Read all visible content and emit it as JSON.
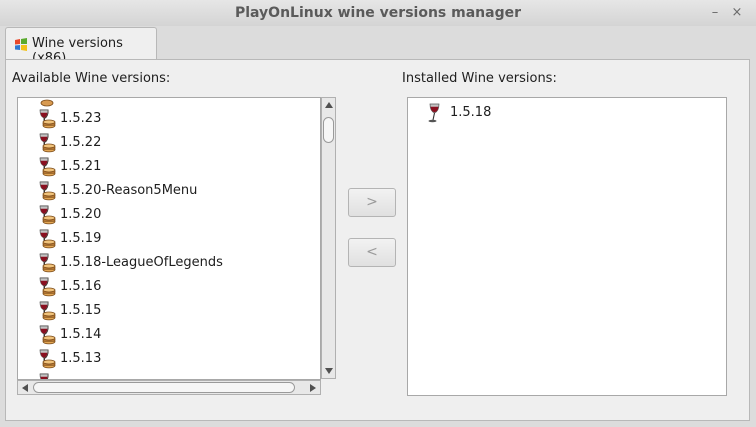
{
  "window": {
    "title": "PlayOnLinux wine versions manager",
    "minimize_glyph": "–",
    "close_glyph": "×"
  },
  "tab": {
    "label": "Wine versions (x86)",
    "icon": "windows-flag-icon"
  },
  "available": {
    "label": "Available Wine versions:",
    "item_icon": "wine-glass-icon",
    "items": [
      "1.5.23",
      "1.5.22",
      "1.5.21",
      "1.5.20-Reason5Menu",
      "1.5.20",
      "1.5.19",
      "1.5.18-LeagueOfLegends",
      "1.5.16",
      "1.5.15",
      "1.5.14",
      "1.5.13"
    ]
  },
  "installed": {
    "label": "Installed Wine versions:",
    "items": [
      "1.5.18"
    ]
  },
  "buttons": {
    "install_label": ">",
    "remove_label": "<"
  }
}
